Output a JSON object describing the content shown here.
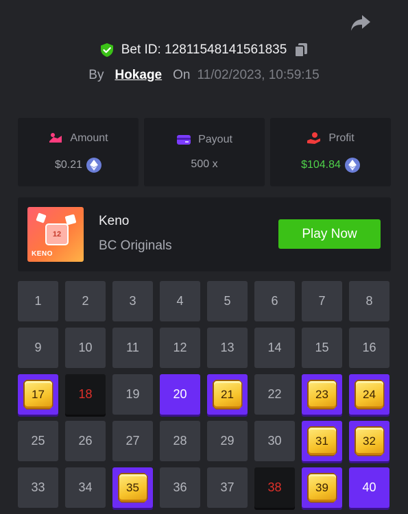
{
  "header": {
    "share_icon": "share-arrow-icon",
    "bet_label": "Bet ID: 12811548141561835",
    "by_label": "By",
    "username": "Hokage",
    "on_label": "On",
    "datetime": "11/02/2023, 10:59:15"
  },
  "stats": [
    {
      "label": "Amount",
      "value": "$0.21",
      "icon": "amount-icon",
      "currency_icon": "eth-icon"
    },
    {
      "label": "Payout",
      "value": "500 x",
      "icon": "payout-card-icon"
    },
    {
      "label": "Profit",
      "value": "$104.84",
      "icon": "profit-icon",
      "currency_icon": "eth-icon"
    }
  ],
  "game": {
    "thumb_number": "12",
    "thumb_logo": "KENO",
    "name": "Keno",
    "provider": "BC Originals",
    "play_label": "Play Now"
  },
  "colors": {
    "background": "#232428",
    "panel": "#1b1c20",
    "tile": "#383a41",
    "selected": "#6c2cf5",
    "play_button": "#3bc117",
    "profit": "#4fd14a",
    "miss_text": "#e0302a"
  },
  "tiles": [
    {
      "n": "1",
      "s": "normal"
    },
    {
      "n": "2",
      "s": "normal"
    },
    {
      "n": "3",
      "s": "normal"
    },
    {
      "n": "4",
      "s": "normal"
    },
    {
      "n": "5",
      "s": "normal"
    },
    {
      "n": "6",
      "s": "normal"
    },
    {
      "n": "7",
      "s": "normal"
    },
    {
      "n": "8",
      "s": "normal"
    },
    {
      "n": "9",
      "s": "normal"
    },
    {
      "n": "10",
      "s": "normal"
    },
    {
      "n": "11",
      "s": "normal"
    },
    {
      "n": "12",
      "s": "normal"
    },
    {
      "n": "13",
      "s": "normal"
    },
    {
      "n": "14",
      "s": "normal"
    },
    {
      "n": "15",
      "s": "normal"
    },
    {
      "n": "16",
      "s": "normal"
    },
    {
      "n": "17",
      "s": "hit"
    },
    {
      "n": "18",
      "s": "miss"
    },
    {
      "n": "19",
      "s": "normal"
    },
    {
      "n": "20",
      "s": "pick"
    },
    {
      "n": "21",
      "s": "hit"
    },
    {
      "n": "22",
      "s": "normal"
    },
    {
      "n": "23",
      "s": "hit"
    },
    {
      "n": "24",
      "s": "hit"
    },
    {
      "n": "25",
      "s": "normal"
    },
    {
      "n": "26",
      "s": "normal"
    },
    {
      "n": "27",
      "s": "normal"
    },
    {
      "n": "28",
      "s": "normal"
    },
    {
      "n": "29",
      "s": "normal"
    },
    {
      "n": "30",
      "s": "normal"
    },
    {
      "n": "31",
      "s": "hit"
    },
    {
      "n": "32",
      "s": "hit"
    },
    {
      "n": "33",
      "s": "normal"
    },
    {
      "n": "34",
      "s": "normal"
    },
    {
      "n": "35",
      "s": "hit"
    },
    {
      "n": "36",
      "s": "normal"
    },
    {
      "n": "37",
      "s": "normal"
    },
    {
      "n": "38",
      "s": "miss"
    },
    {
      "n": "39",
      "s": "hit"
    },
    {
      "n": "40",
      "s": "pick"
    }
  ]
}
